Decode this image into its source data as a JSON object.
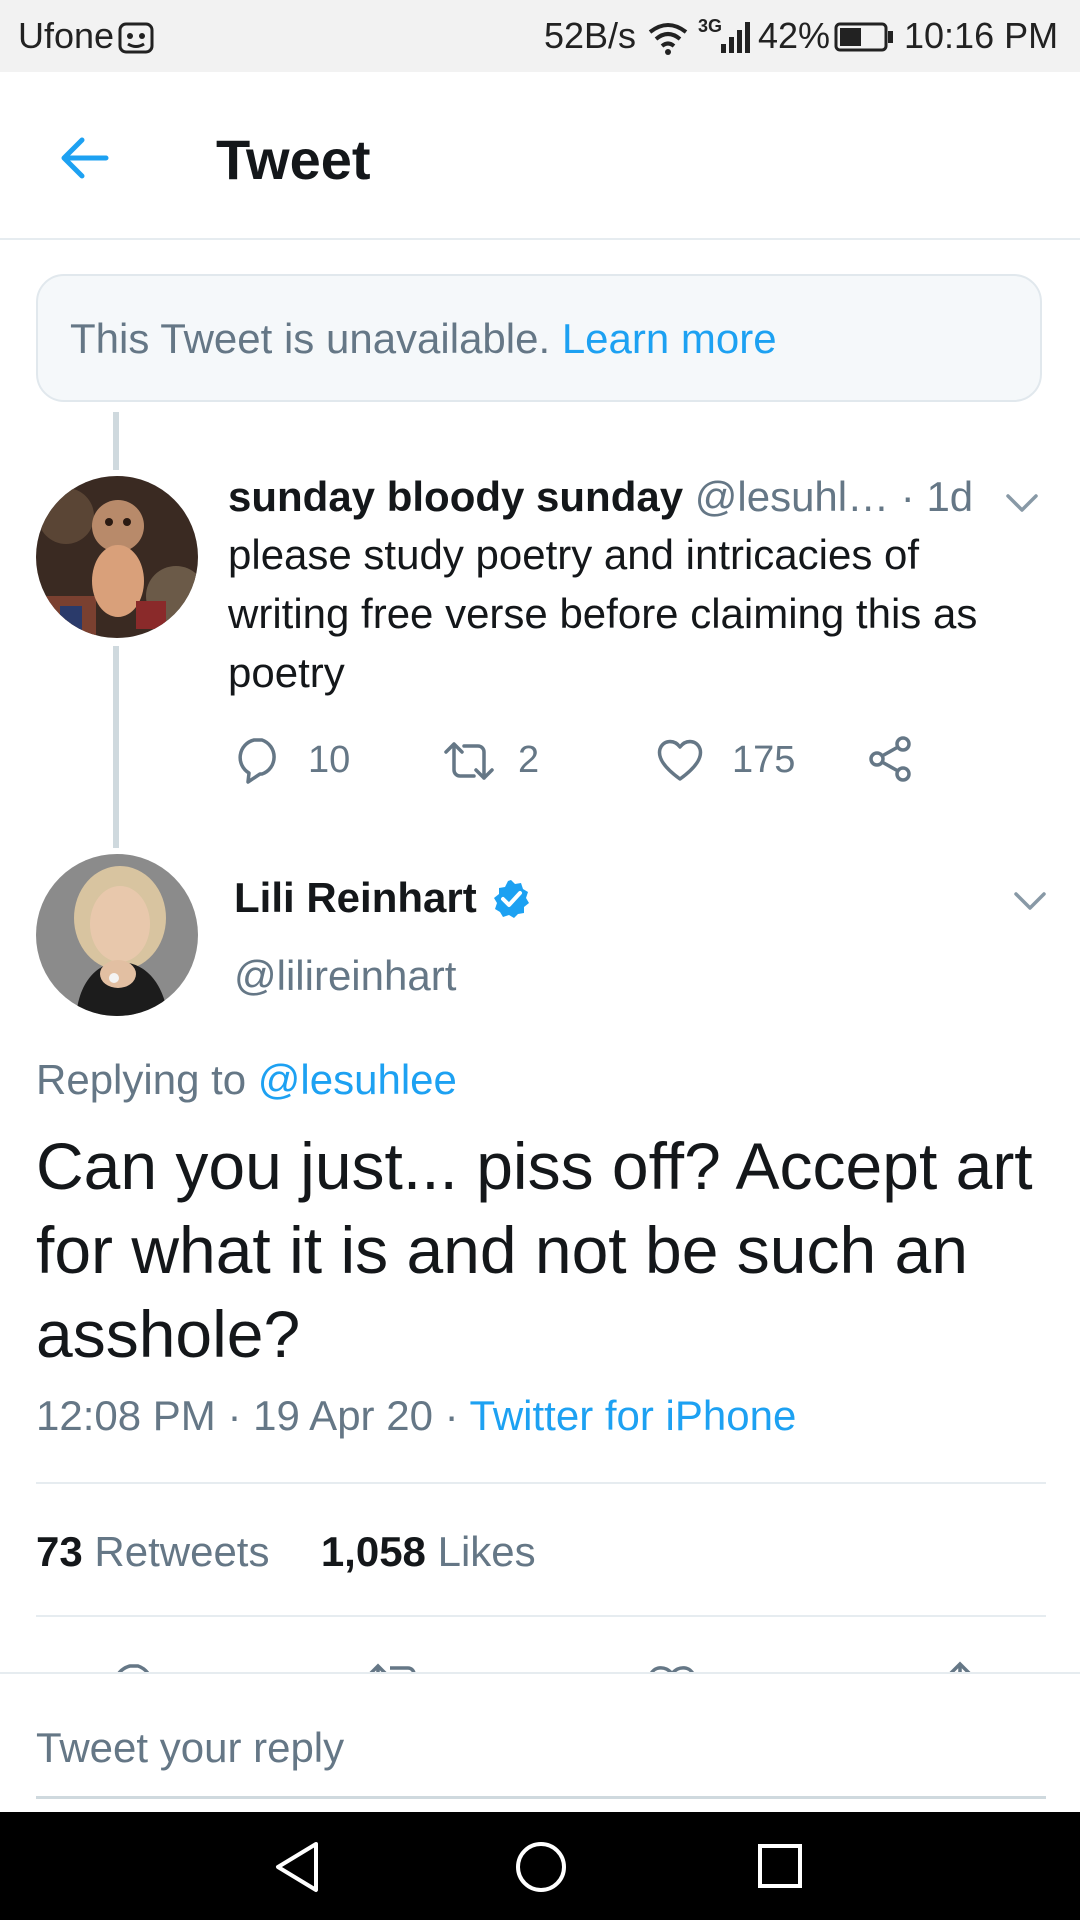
{
  "status_bar": {
    "carrier": "Ufone",
    "speed": "52B/s",
    "network": "3G",
    "battery": "42%",
    "time": "10:16 PM"
  },
  "header": {
    "title": "Tweet"
  },
  "unavailable": {
    "text": "This Tweet is unavailable.",
    "link": "Learn more"
  },
  "parent_tweet": {
    "name": "sunday bloody sunday",
    "handle": "@lesuhl…",
    "time": "· 1d",
    "text": "please study poetry and intricacies of writing free verse before claiming this as poetry",
    "replies": "10",
    "retweets": "2",
    "likes": "175"
  },
  "main_tweet": {
    "name": "Lili Reinhart",
    "handle": "@lilireinhart",
    "replying_prefix": "Replying to",
    "replying_handle": "@lesuhlee",
    "text": "Can you just... piss off? Accept art for what it is and not be such an asshole?",
    "time": "12:08 PM",
    "date": "· 19 Apr 20 ·",
    "source": "Twitter for iPhone",
    "retweets_count": "73",
    "retweets_label": "Retweets",
    "likes_count": "1,058",
    "likes_label": "Likes"
  },
  "reply_box": {
    "placeholder": "Tweet your reply"
  },
  "colors": {
    "accent": "#1da1f2",
    "text": "#14171a",
    "muted": "#657786"
  }
}
